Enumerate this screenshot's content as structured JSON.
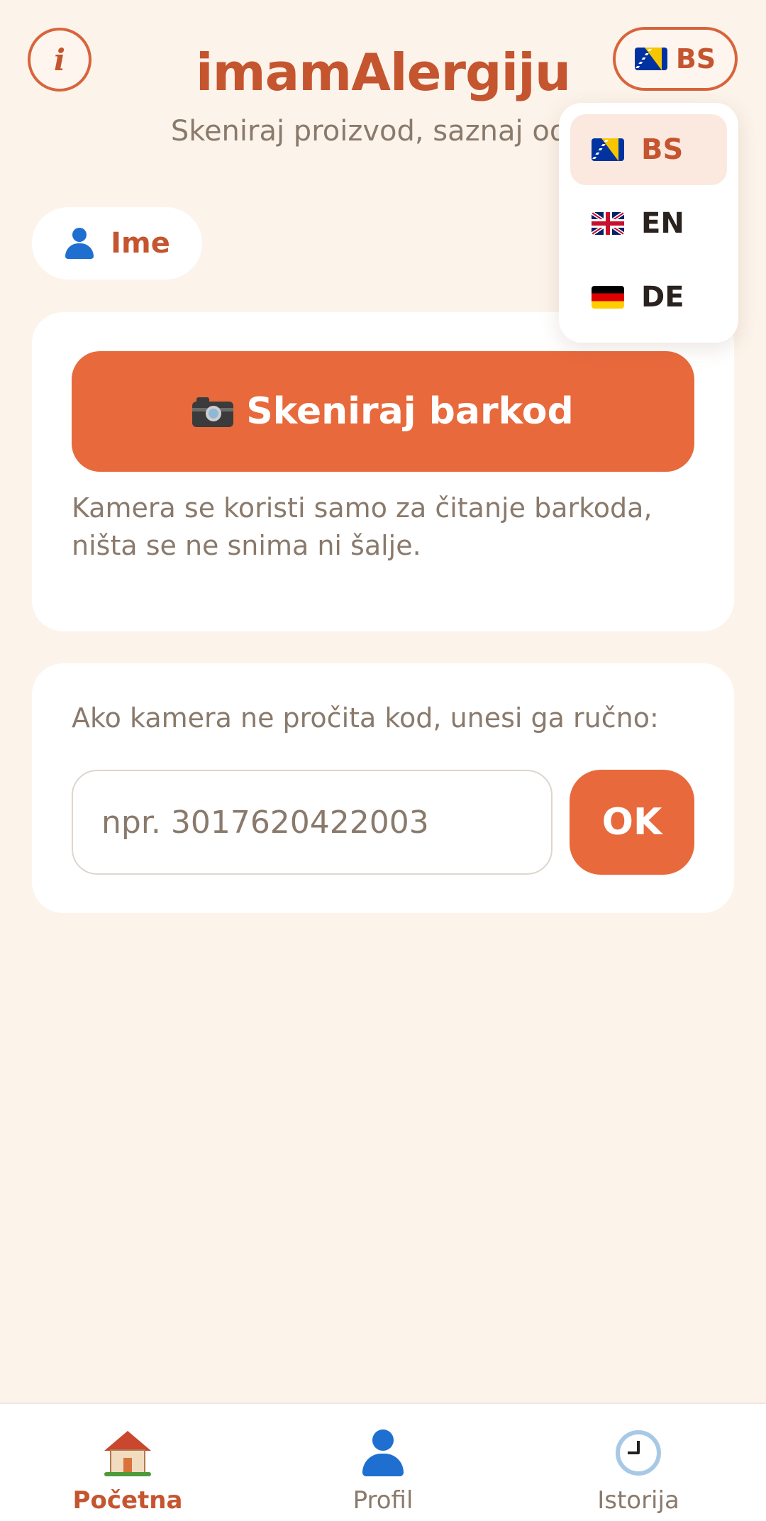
{
  "header": {
    "info_icon_glyph": "i",
    "title": "imamAlergiju",
    "subtitle": "Skeniraj proizvod, saznaj odm",
    "language_button": {
      "flag": "bosnia-flag",
      "code": "BS"
    }
  },
  "language_menu": {
    "options": [
      {
        "code": "BS",
        "flag": "bosnia-flag",
        "selected": true
      },
      {
        "code": "EN",
        "flag": "uk-flag",
        "selected": false
      },
      {
        "code": "DE",
        "flag": "germany-flag",
        "selected": false
      }
    ]
  },
  "profile_chip": {
    "label": "Ime",
    "icon": "person-icon"
  },
  "scan_card": {
    "button_label": "Skeniraj barkod",
    "button_icon": "camera-icon",
    "note": "Kamera se koristi samo za čitanje barkoda, ništa se ne snima ni šalje."
  },
  "manual_card": {
    "label": "Ako kamera ne pročita kod, unesi ga ručno:",
    "input_value": "",
    "input_placeholder": "npr. 3017620422003",
    "ok_label": "OK"
  },
  "bottom_nav": {
    "items": [
      {
        "label": "Početna",
        "icon": "house-icon",
        "active": true
      },
      {
        "label": "Profil",
        "icon": "person-icon",
        "active": false
      },
      {
        "label": "Istorija",
        "icon": "clock-icon",
        "active": false
      }
    ]
  },
  "colors": {
    "accent": "#e8693c",
    "accent_text": "#c4552f",
    "background": "#fcf3ea",
    "muted_text": "#8a7a6c"
  }
}
